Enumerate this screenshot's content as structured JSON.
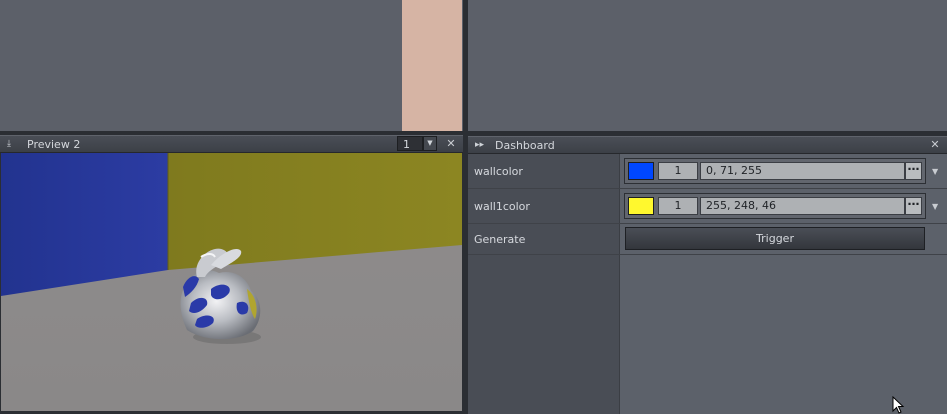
{
  "preview": {
    "title": "Preview 2",
    "number": "1"
  },
  "dashboard": {
    "title": "Dashboard",
    "params": [
      {
        "label": "wallcolor",
        "color": "#0047ff",
        "spin": "1",
        "value": "0, 71, 255"
      },
      {
        "label": "wall1color",
        "color": "#fff82e",
        "spin": "1",
        "value": "255, 248, 46"
      }
    ],
    "generate": {
      "label": "Generate",
      "button": "Trigger"
    },
    "ellipsis": "⋯"
  },
  "colors": {
    "panel_bg": "#5c6069",
    "strip": "#d6b4a4",
    "blue_wall": "#26379c",
    "yellow_wall": "#8a8420",
    "floor": "#8e8b8b"
  },
  "icons": {
    "preview_toggle": "collapse-arrow-icon",
    "dash_toggle": "expand-arrows-icon",
    "close": "close-icon",
    "cursor": "mouse-pointer-icon"
  }
}
